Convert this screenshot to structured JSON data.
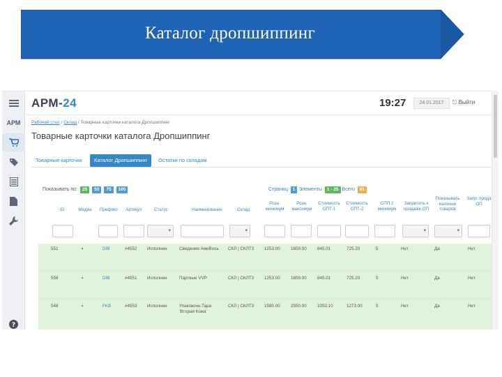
{
  "slide": {
    "title": "Каталог дропшиппинг",
    "banner_color": "#1f63b6"
  },
  "app": {
    "brand_prefix": "АРМ-",
    "brand_number": "24",
    "sidebar_label": "АРМ",
    "time": "19:27",
    "date": "24.01.2017",
    "logout": "Выйти",
    "accent": "#3487c9"
  },
  "breadcrumb": {
    "home": "Рабочий стол",
    "warehouse": "Склад",
    "current": "/ Товарные карточки каталога Дропшиппинг"
  },
  "page_title": "Товарные карточки каталога Дропшиппинг",
  "tabs": [
    "Товарные карточки",
    "Каталог Дропшиппинг",
    "Остатки по складам"
  ],
  "active_tab": 1,
  "controls": {
    "show_label": "Показывать по:",
    "page_sizes": [
      "25",
      "50",
      "75",
      "100"
    ]
  },
  "stats": {
    "pages_label": "Страниц",
    "pages_value": "1",
    "items_label": "Элементы",
    "items_value": "1 - 25",
    "total_label": "Всего",
    "total_value": "81"
  },
  "columns": [
    "ID",
    "Медиа",
    "Префикс",
    "Артикул",
    "Статус",
    "Наименование",
    "Склад",
    "Розн. минимум",
    "Розн. максимум",
    "Стоимость ОПТ-1",
    "Стоимость ОПТ-2",
    "СПП 2 минимум",
    "Запретить к продаже ОП",
    "Показывать наличие товаров",
    "Запр. прода ОП"
  ],
  "rows": [
    [
      "551",
      "▪",
      "DIB",
      "#4552",
      "Исполнен",
      "Сведения АмеВось",
      "СКЛ | СКЛТ3",
      "1253.00",
      "1659.00",
      "845.01",
      "725.20",
      "5",
      "Нет",
      "Да",
      "Нет"
    ],
    [
      "558",
      "▪",
      "DIB",
      "#4551",
      "Исполнен",
      "Партвые VVP",
      "СКЛ | СКЛТ3",
      "1253.00",
      "1659.00",
      "845.01",
      "725.20",
      "5",
      "Нет",
      "Да",
      "Нет"
    ],
    [
      "548",
      "▪",
      "FKB",
      "#4553",
      "Исполнен",
      "Упаковочн.Тара 'Вторая Кожа'",
      "СКЛ | СКЛТ3",
      "1590.00",
      "2550.00",
      "1053.10",
      "1273.00",
      "5",
      "Нет",
      "Да",
      "Нет"
    ]
  ]
}
